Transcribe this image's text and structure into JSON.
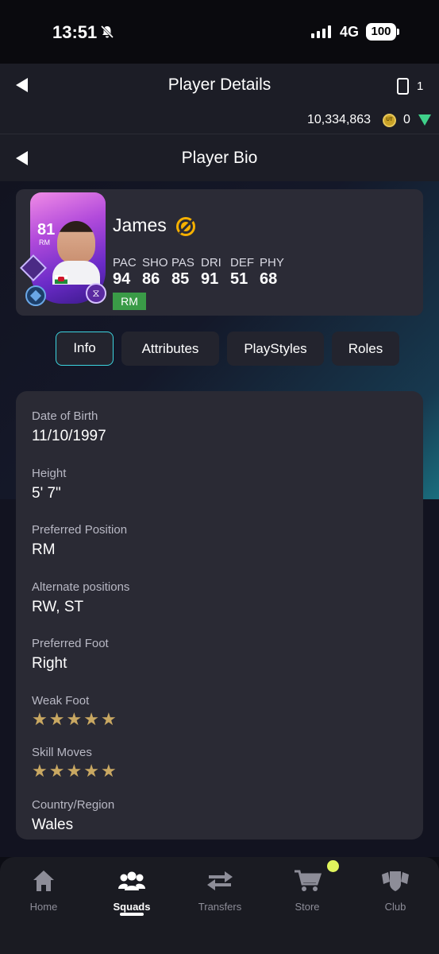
{
  "status_bar": {
    "time": "13:51",
    "network": "4G",
    "battery": "100"
  },
  "header": {
    "title": "Player Details",
    "card_count": "1",
    "coins": "10,334,863",
    "coin_icon_label": "UT",
    "points": "0"
  },
  "subheader": {
    "title": "Player Bio"
  },
  "player": {
    "name": "James",
    "rating": "81",
    "position_on_card": "RM",
    "position_badge": "RM",
    "stats": [
      {
        "label": "PAC",
        "value": "94"
      },
      {
        "label": "SHO",
        "value": "86"
      },
      {
        "label": "PAS",
        "value": "85"
      },
      {
        "label": "DRI",
        "value": "91"
      },
      {
        "label": "DEF",
        "value": "51"
      },
      {
        "label": "PHY",
        "value": "68"
      }
    ]
  },
  "tabs": [
    {
      "label": "Info",
      "active": true
    },
    {
      "label": "Attributes",
      "active": false
    },
    {
      "label": "PlayStyles",
      "active": false
    },
    {
      "label": "Roles",
      "active": false
    }
  ],
  "info": {
    "dob": {
      "label": "Date of Birth",
      "value": "11/10/1997"
    },
    "height": {
      "label": "Height",
      "value": "5' 7\""
    },
    "preferred_position": {
      "label": "Preferred Position",
      "value": "RM"
    },
    "alternate_positions": {
      "label": "Alternate positions",
      "value": "RW, ST"
    },
    "preferred_foot": {
      "label": "Preferred Foot",
      "value": "Right"
    },
    "weak_foot": {
      "label": "Weak Foot",
      "stars": 5
    },
    "skill_moves": {
      "label": "Skill Moves",
      "stars": 5
    },
    "country": {
      "label": "Country/Region",
      "value": "Wales"
    }
  },
  "nav": [
    {
      "label": "Home",
      "icon": "home-icon"
    },
    {
      "label": "Squads",
      "icon": "squads-icon"
    },
    {
      "label": "Transfers",
      "icon": "transfers-icon"
    },
    {
      "label": "Store",
      "icon": "store-icon"
    },
    {
      "label": "Club",
      "icon": "club-icon"
    }
  ],
  "colors": {
    "accent": "#3cd5e0",
    "position_green": "#3a9b47",
    "star_gold": "#c9a862",
    "notification": "#e1f55d"
  }
}
